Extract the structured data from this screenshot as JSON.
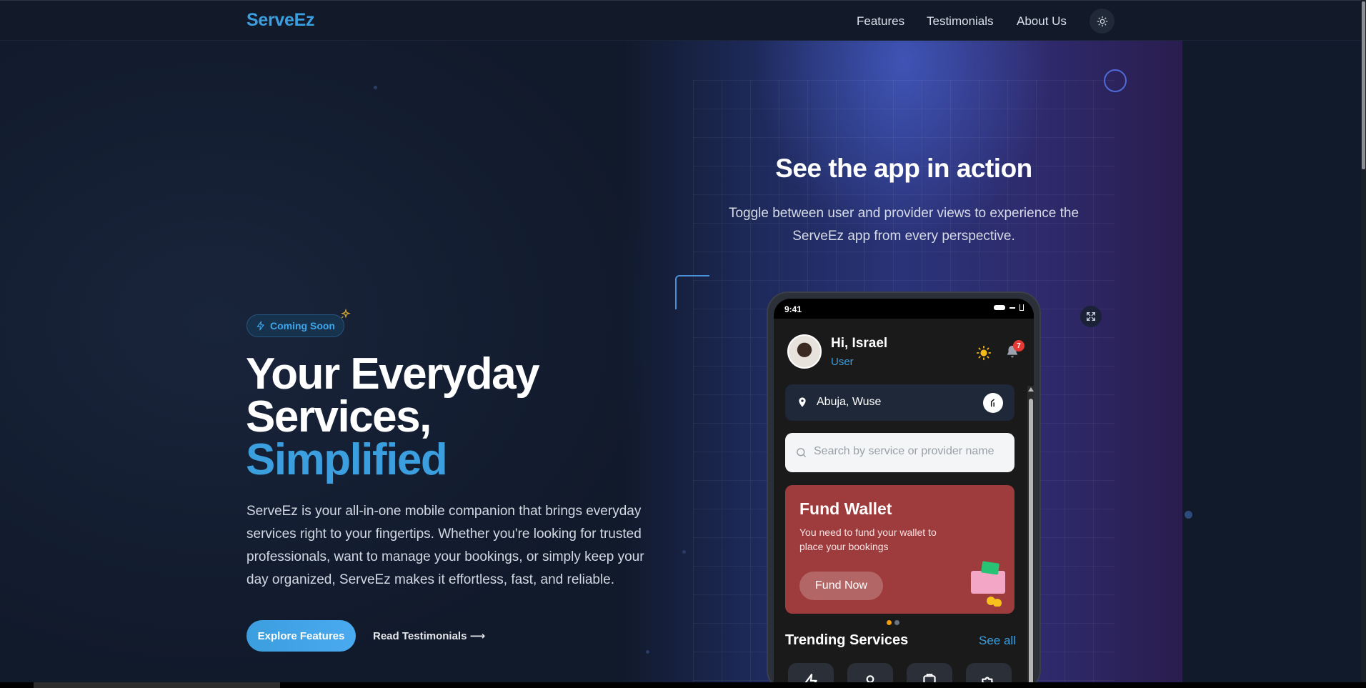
{
  "nav": {
    "logo": "ServeEz",
    "links": [
      "Features",
      "Testimonials",
      "About Us"
    ]
  },
  "hero": {
    "badge": "Coming Soon",
    "title_line1": "Your Everyday",
    "title_line2": "Services,",
    "title_accent": "Simplified",
    "description": "ServeEz is your all-in-one mobile companion that brings everyday services right to your fingertips. Whether you're looking for trusted professionals, want to manage your bookings, or simply keep your day organized, ServeEz makes it effortless, fast, and reliable.",
    "primary_button": "Explore Features",
    "secondary_link": "Read Testimonials ⟶"
  },
  "showcase": {
    "title": "See the app in action",
    "subtitle": "Toggle between user and provider views to experience the ServeEz app from every perspective."
  },
  "app": {
    "time": "9:41",
    "greeting": "Hi, Israel",
    "role": "User",
    "notification_count": "7",
    "location": "Abuja, Wuse",
    "search_placeholder": "Search by service or provider name",
    "wallet": {
      "title": "Fund Wallet",
      "description": "You need to fund your wallet to place your bookings",
      "button": "Fund Now"
    },
    "trending_title": "Trending Services",
    "see_all": "See all",
    "service_icons": [
      "bolt-icon",
      "person-icon",
      "clipboard-icon",
      "puzzle-icon"
    ]
  },
  "colors": {
    "accent": "#3b9ede",
    "background": "#111827",
    "wallet_card": "#9e3b3c",
    "notification_badge": "#e53935"
  }
}
